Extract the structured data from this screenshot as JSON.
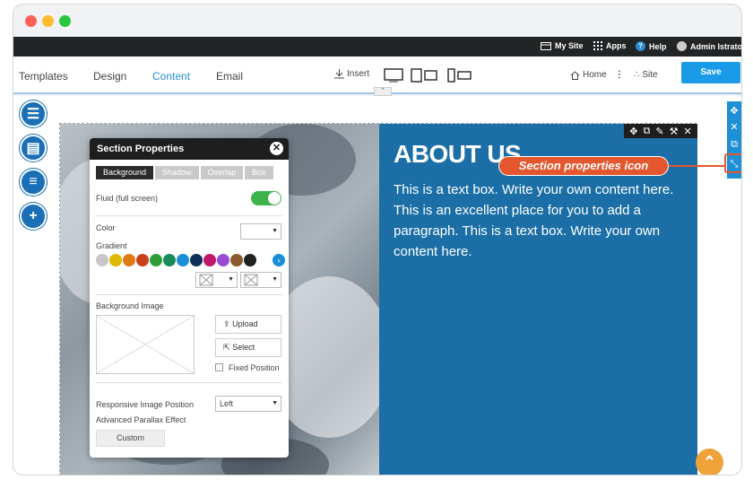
{
  "admin_bar": {
    "my_site": "My Site",
    "apps": "Apps",
    "help": "Help",
    "user": "Admin Istrator"
  },
  "toolbar": {
    "tabs": [
      "Templates",
      "Design",
      "Content",
      "Email"
    ],
    "active_tab": "Content",
    "insert": "Insert",
    "home": "Home",
    "site": "Site",
    "save": "Save"
  },
  "section": {
    "title": "ABOUT US",
    "body": "This is a text box. Write your own content here. This is an excellent place for you to add a paragraph. This is a text box. Write your own content here."
  },
  "callout": {
    "label": "Section properties icon"
  },
  "panel": {
    "title": "Section Properties",
    "tabs": [
      "Background",
      "Shadow",
      "Overlap",
      "Box"
    ],
    "fluid_label": "Fluid (full screen)",
    "fluid_enabled": true,
    "color_label": "Color",
    "gradient_label": "Gradient",
    "gradient_swatches": [
      "#c7c7c7",
      "#e0b800",
      "#e07a12",
      "#c9401c",
      "#2f9e3a",
      "#1a8a5a",
      "#1a8fd6",
      "#0f2f5a",
      "#c2186b",
      "#9a4bd6",
      "#8a5a2a",
      "#222222"
    ],
    "background_image_label": "Background Image",
    "upload_label": "Upload",
    "select_label": "Select",
    "fixed_position_label": "Fixed Position",
    "responsive_label": "Responsive Image Position",
    "responsive_value": "Left",
    "parallax_label": "Advanced Parallax Effect",
    "custom_label": "Custom"
  },
  "colors": {
    "accent": "#1a9be8",
    "section_blue": "#1b6fa6",
    "callout": "#e4572e",
    "scroll_top": "#f0a23a"
  }
}
